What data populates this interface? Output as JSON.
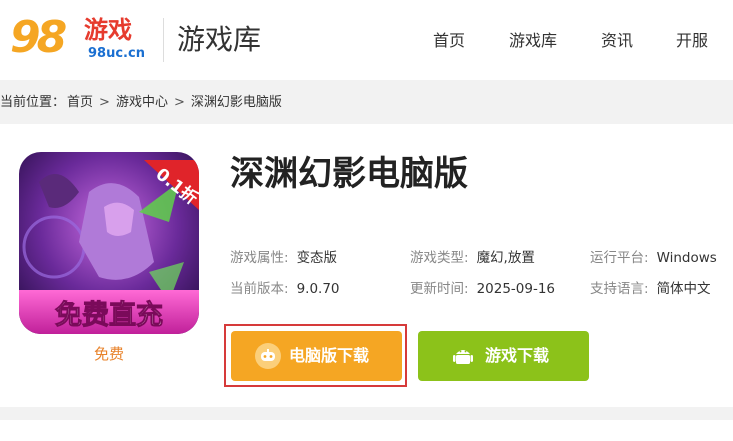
{
  "logo": {
    "number": "98",
    "name": "游戏",
    "url": "98uc.cn"
  },
  "header": {
    "title": "游戏库"
  },
  "nav": {
    "items": [
      {
        "label": "首页"
      },
      {
        "label": "游戏库"
      },
      {
        "label": "资讯"
      },
      {
        "label": "开服"
      }
    ]
  },
  "breadcrumb": {
    "prefix": "当前位置：",
    "items": [
      "首页",
      "游戏中心",
      "深渊幻影电脑版"
    ],
    "separator": ">"
  },
  "game": {
    "title": "深渊幻影电脑版",
    "price": "免费",
    "icon_badge": "0.1折",
    "icon_banner": "免费直充",
    "attributes": [
      {
        "key": "游戏属性:",
        "value": "变态版"
      },
      {
        "key": "游戏类型:",
        "value": "魔幻,放置"
      },
      {
        "key": "运行平台:",
        "value": "Windows"
      },
      {
        "key": "当前版本:",
        "value": "9.0.70"
      },
      {
        "key": "更新时间:",
        "value": "2025-09-16"
      },
      {
        "key": "支持语言:",
        "value": "简体中文"
      }
    ]
  },
  "buttons": {
    "pc_download": {
      "label": "电脑版下载",
      "icon": "gamepad-icon",
      "color": "#f5a623"
    },
    "game_download": {
      "label": "游戏下载",
      "icon": "android-icon",
      "color": "#8cc21a"
    }
  },
  "colors": {
    "highlight": "#d63a3a",
    "price": "#e8822a"
  }
}
